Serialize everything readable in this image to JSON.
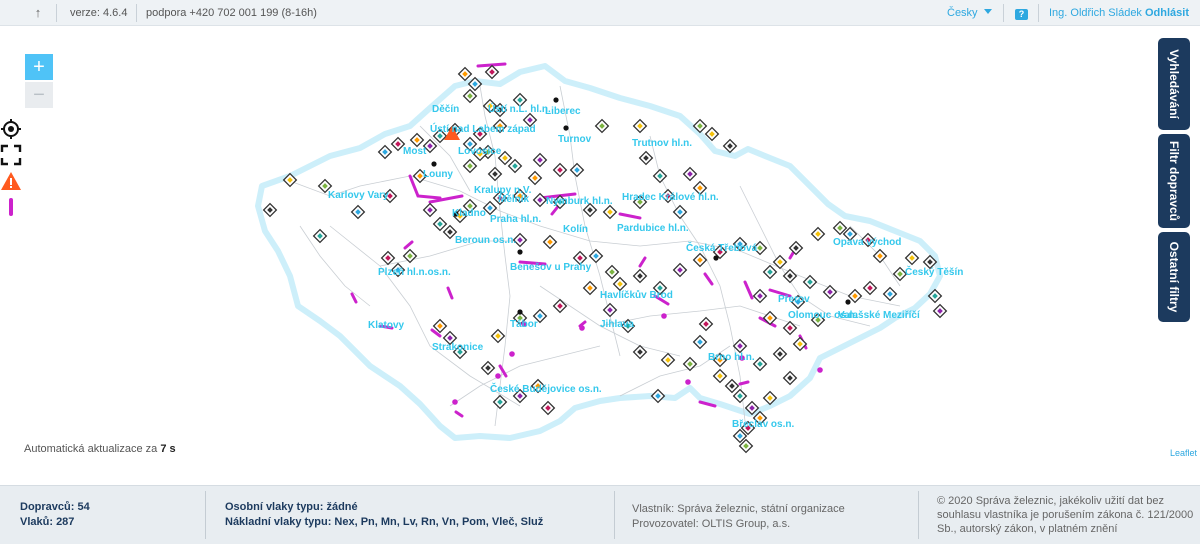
{
  "topbar": {
    "version": "verze: 4.6.4",
    "support": "podpora +420 702 001 199 (8-16h)",
    "language": "Česky",
    "help_icon": "help-icon",
    "user": "Ing. Oldřich Sládek",
    "logout": "Odhlásit"
  },
  "controls": {
    "zoom_in": "+",
    "zoom_out": "−",
    "icons": [
      "locate-icon",
      "fullscreen-icon",
      "warning-icon",
      "magenta-line-icon"
    ]
  },
  "side_buttons": [
    "Vyhledávání",
    "Filtr dopravců",
    "Ostatní filtry"
  ],
  "map": {
    "cities": [
      "Ústí n.L. hl.n.",
      "Liberec",
      "Děčín",
      "Ústí nad Labem západ",
      "Turnov",
      "Most",
      "Lovosice",
      "Trutnov hl.n.",
      "Louny",
      "Karlovy Vary",
      "Hradec Králové hl.n.",
      "Kralupy n.V.",
      "Mělník",
      "Nymburk hl.n.",
      "Kladno",
      "Praha hl.n.",
      "Kolín",
      "Pardubice hl.n.",
      "Beroun os.n.",
      "Česká Třebová",
      "Opava východ",
      "Benešov u Prahy",
      "Český Těšín",
      "Plzeň hl.n.os.n.",
      "Havlíčkův Brod",
      "Přerov",
      "Klatovy",
      "Tábor",
      "Jihlava",
      "Olomouc os.n.",
      "Valašské Meziříčí",
      "Strakonice",
      "Brno hl.n.",
      "České Budějovice os.n.",
      "Břeclav os.n."
    ]
  },
  "auto_update": {
    "label": "Automatická aktualizace za",
    "value": "7 s"
  },
  "attribution": "Leaflet",
  "footer": {
    "carriers": "Dopravců: 54",
    "trains": "Vlaků: 287",
    "passenger_types": "Osobní vlaky typu: žádné",
    "freight_types": "Nákladní vlaky typu: Nex, Pn, Mn, Lv, Rn, Vn, Pom, Vleč, Služ",
    "owner": "Vlastník: Správa železnic, státní organizace",
    "operator": "Provozovatel: OLTIS Group, a.s.",
    "copyright_1": "© 2020 Správa železnic, jakékoliv užití dat bez",
    "copyright_2": "souhlasu vlastníka je porušením zákona č. 121/2000",
    "copyright_3": "Sb., autorský zákon, v platném znění"
  },
  "colors": {
    "accent": "#2ea8e0",
    "border_glow": "#cdeffa",
    "closure_line": "#cc22cc",
    "navy": "#1c3a5e",
    "warning": "#ff5a1f"
  }
}
